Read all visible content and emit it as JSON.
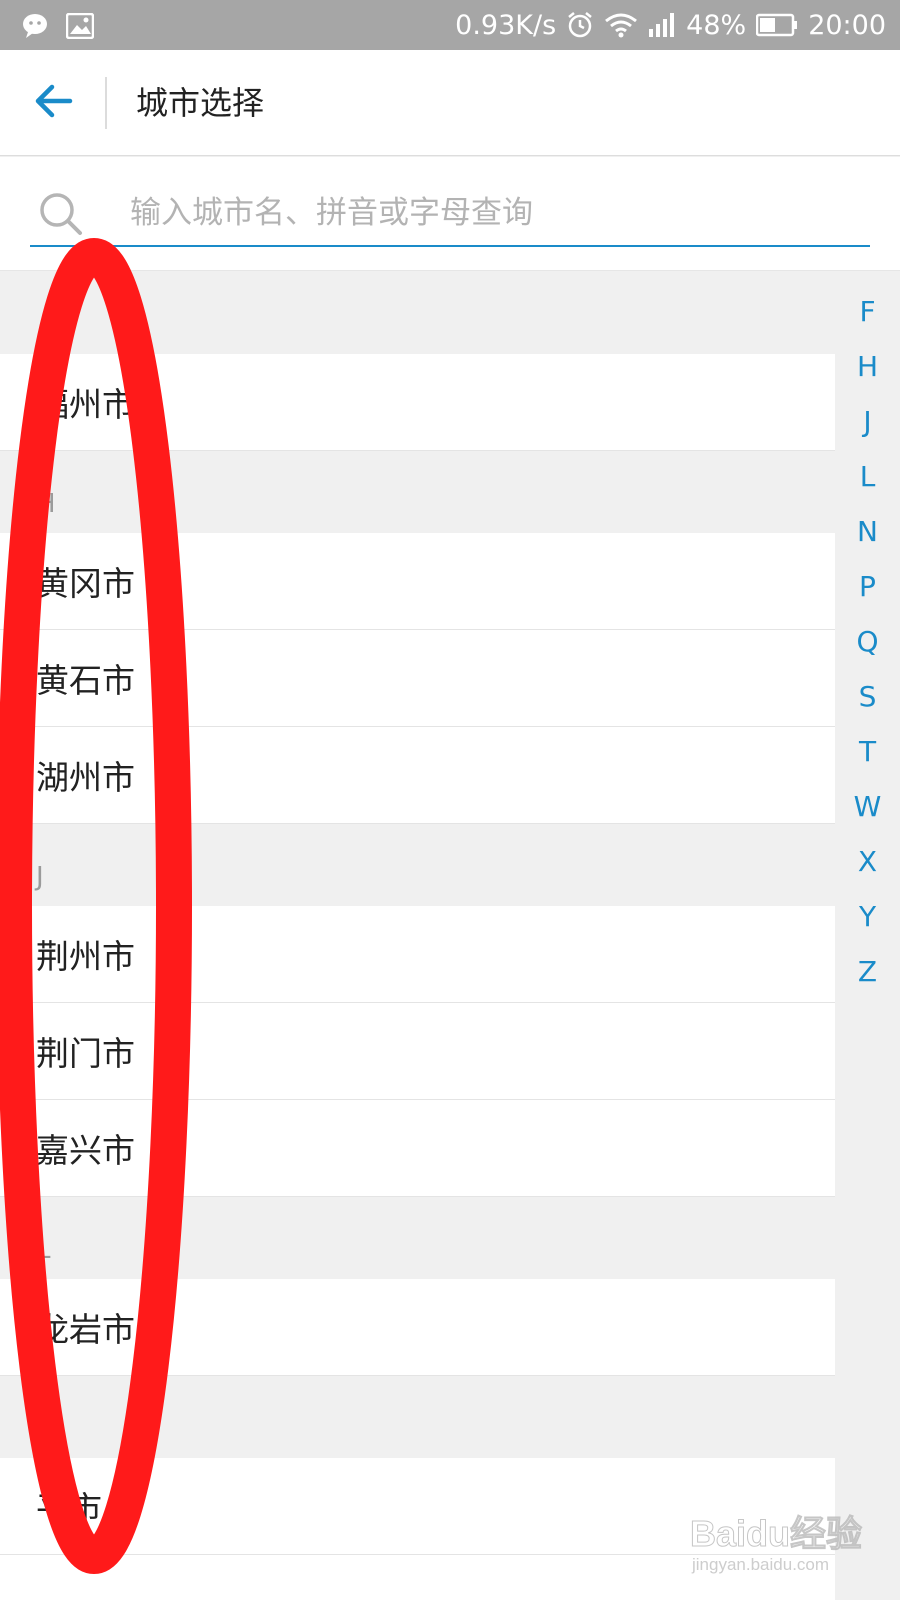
{
  "status_bar": {
    "net_speed": "0.93K/s",
    "battery": "48%",
    "time": "20:00",
    "icons": [
      "wechat-icon",
      "image-icon",
      "alarm-icon",
      "wifi-icon",
      "signal-icon",
      "battery-icon"
    ]
  },
  "header": {
    "title": "城市选择",
    "back_icon": "arrow-left-icon"
  },
  "search": {
    "placeholder": "输入城市名、拼音或字母查询",
    "value": ""
  },
  "sections": [
    {
      "letter": "",
      "cities": [
        "福州市"
      ]
    },
    {
      "letter": "H",
      "cities": [
        "黄冈市",
        "黄石市",
        "湖州市"
      ]
    },
    {
      "letter": "J",
      "cities": [
        "荆州市",
        "荆门市",
        "嘉兴市"
      ]
    },
    {
      "letter": "L",
      "cities": [
        "龙岩市"
      ]
    },
    {
      "letter": "",
      "cities": [
        "平市",
        ""
      ]
    }
  ],
  "index_letters": [
    "F",
    "H",
    "J",
    "L",
    "N",
    "P",
    "Q",
    "S",
    "T",
    "W",
    "X",
    "Y",
    "Z"
  ],
  "watermark": {
    "main": "Baidu经验",
    "sub": "jingyan.baidu.com"
  },
  "colors": {
    "accent": "#1a8bc9",
    "annotation": "#ff1a1a",
    "status_bar": "#a6a6a6"
  }
}
